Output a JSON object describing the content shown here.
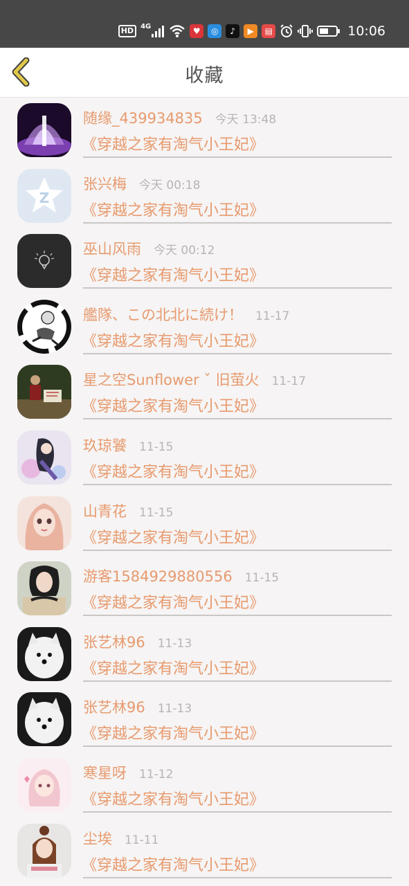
{
  "status_bar": {
    "hd_label": "HD",
    "network_label": "4G",
    "time": "10:06",
    "icons": [
      "hd-icon",
      "signal-icon",
      "wifi-icon",
      "app-heart-icon",
      "app-browser-icon",
      "tiktok-icon",
      "app-video-icon",
      "app-book-icon",
      "alarm-icon",
      "vibrate-icon",
      "battery-icon"
    ]
  },
  "header": {
    "title": "收藏",
    "back_icon": "chevron-left-icon",
    "accent_color": "#e2c84a"
  },
  "favorites": [
    {
      "name": "随缘_439934835",
      "time": "今天 13:48",
      "book": "《穿越之家有淘气小王妃》",
      "avatar": "purple-fountain-avatar"
    },
    {
      "name": "张兴梅",
      "time": "今天 00:18",
      "book": "《穿越之家有淘气小王妃》",
      "avatar": "qq-star-avatar"
    },
    {
      "name": "巫山风雨",
      "time": "今天 00:12",
      "book": "《穿越之家有淘气小王妃》",
      "avatar": "balloon-logo-avatar"
    },
    {
      "name": "艦隊、この北北に続け！",
      "time": "11-17",
      "book": "《穿越之家有淘气小王妃》",
      "avatar": "anime-sketch-avatar"
    },
    {
      "name": "星之空Sunflower ˇ 旧萤火",
      "time": "11-17",
      "book": "《穿越之家有淘气小王妃》",
      "avatar": "photo-person-avatar"
    },
    {
      "name": "玖琼饕",
      "time": "11-15",
      "book": "《穿越之家有淘气小王妃》",
      "avatar": "anime-girl-avatar"
    },
    {
      "name": "山青花",
      "time": "11-15",
      "book": "《穿越之家有淘气小王妃》",
      "avatar": "doll-avatar"
    },
    {
      "name": "游客1584929880556",
      "time": "11-15",
      "book": "《穿越之家有淘气小王妃》",
      "avatar": "girl-photo-avatar"
    },
    {
      "name": "张艺林96",
      "time": "11-13",
      "book": "《穿越之家有淘气小王妃》",
      "avatar": "white-dog-avatar"
    },
    {
      "name": "张艺林96",
      "time": "11-13",
      "book": "《穿越之家有淘气小王妃》",
      "avatar": "white-dog-avatar"
    },
    {
      "name": "寒星呀",
      "time": "11-12",
      "book": "《穿越之家有淘气小王妃》",
      "avatar": "pink-anime-avatar"
    },
    {
      "name": "尘埃",
      "time": "11-11",
      "book": "《穿越之家有淘气小王妃》",
      "avatar": "woman-photo-avatar"
    }
  ],
  "colors": {
    "name_color": "#e79a6e",
    "time_color": "#b8b4b4",
    "status_bar_bg": "#474747",
    "page_bg": "#f6f4f4"
  }
}
